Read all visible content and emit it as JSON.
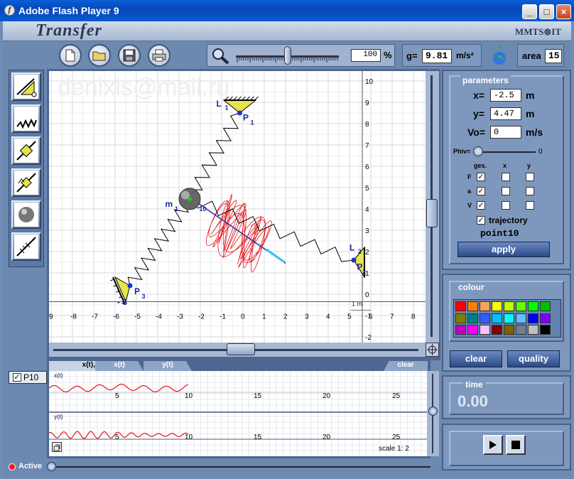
{
  "window": {
    "title": "Adobe Flash Player 9",
    "minimize": "_",
    "maximize": "□",
    "close": "×"
  },
  "banner": {
    "app_title": "Transfer",
    "brand": "MMTS⊗IT"
  },
  "toolbar": {
    "zoom_value": "100",
    "zoom_unit": "%",
    "g_label": "g=",
    "g_value": "9.81",
    "g_unit": "m/s²",
    "area_label": "area",
    "area_value": "15"
  },
  "watermark": "denixis@mail.ru",
  "scene": {
    "x_ticks": [
      "9",
      "-8",
      "-7",
      "-6",
      "-5",
      "-4",
      "-3",
      "-2",
      "-1",
      "0",
      "1",
      "2",
      "3",
      "4",
      "5",
      "6",
      "7",
      "8"
    ],
    "y_ticks": [
      "10",
      "9",
      "8",
      "7",
      "6",
      "5",
      "4",
      "3",
      "2",
      "1",
      "0",
      "-1",
      "-2"
    ],
    "labels": {
      "L1": "L",
      "L1s": "1",
      "P1": "P",
      "P1s": "1",
      "m1": "m",
      "m1s": "1",
      "m1t": "10",
      "L2": "L",
      "L2s": "2",
      "P2": "P",
      "P2s": "2",
      "P3": "P",
      "P3s": "3",
      "L3": "- 3",
      "scale": "1 m"
    }
  },
  "parameters": {
    "title": "parameters",
    "x_label": "x=",
    "x_value": "-2.5",
    "x_unit": "m",
    "y_label": "y=",
    "y_value": "4.47",
    "y_unit": "m",
    "v_label": "Vo=",
    "v_value": "0",
    "v_unit": "m/s",
    "phi_label": "Phiv=",
    "phi_value": "0",
    "col_ges": "ges.",
    "col_x": "x",
    "col_y": "y",
    "row_F": "F",
    "row_a": "a",
    "row_V": "V",
    "trajectory_label": "trajectory",
    "point_label": "point10",
    "apply_label": "apply"
  },
  "colour": {
    "title": "colour",
    "swatches": [
      "#ff0000",
      "#ff8000",
      "#ffa060",
      "#ffff00",
      "#c0ff00",
      "#60ff00",
      "#00ff00",
      "#00c000",
      "#808000",
      "#008080",
      "#3060ff",
      "#00c0ff",
      "#00ffff",
      "#60c0ff",
      "#0000ff",
      "#8000ff",
      "#c000c0",
      "#ff00ff",
      "#ffc0ff",
      "#800000",
      "#806000",
      "#708090",
      "#c0c0c0",
      "#000000"
    ],
    "clear_label": "clear",
    "quality_label": "quality"
  },
  "time": {
    "title": "time",
    "value": "0.00"
  },
  "graph": {
    "point_label": "P10",
    "tabs": [
      "x(t), y(t)",
      "x(t)",
      "y(t)"
    ],
    "clear_tab": "clear",
    "top_axis_label": "x(t)",
    "bottom_axis_label": "y(t)",
    "ticks": [
      "5",
      "10",
      "15",
      "20",
      "25"
    ],
    "scale": "scale 1: 2"
  },
  "status": {
    "active_label": "Active"
  }
}
